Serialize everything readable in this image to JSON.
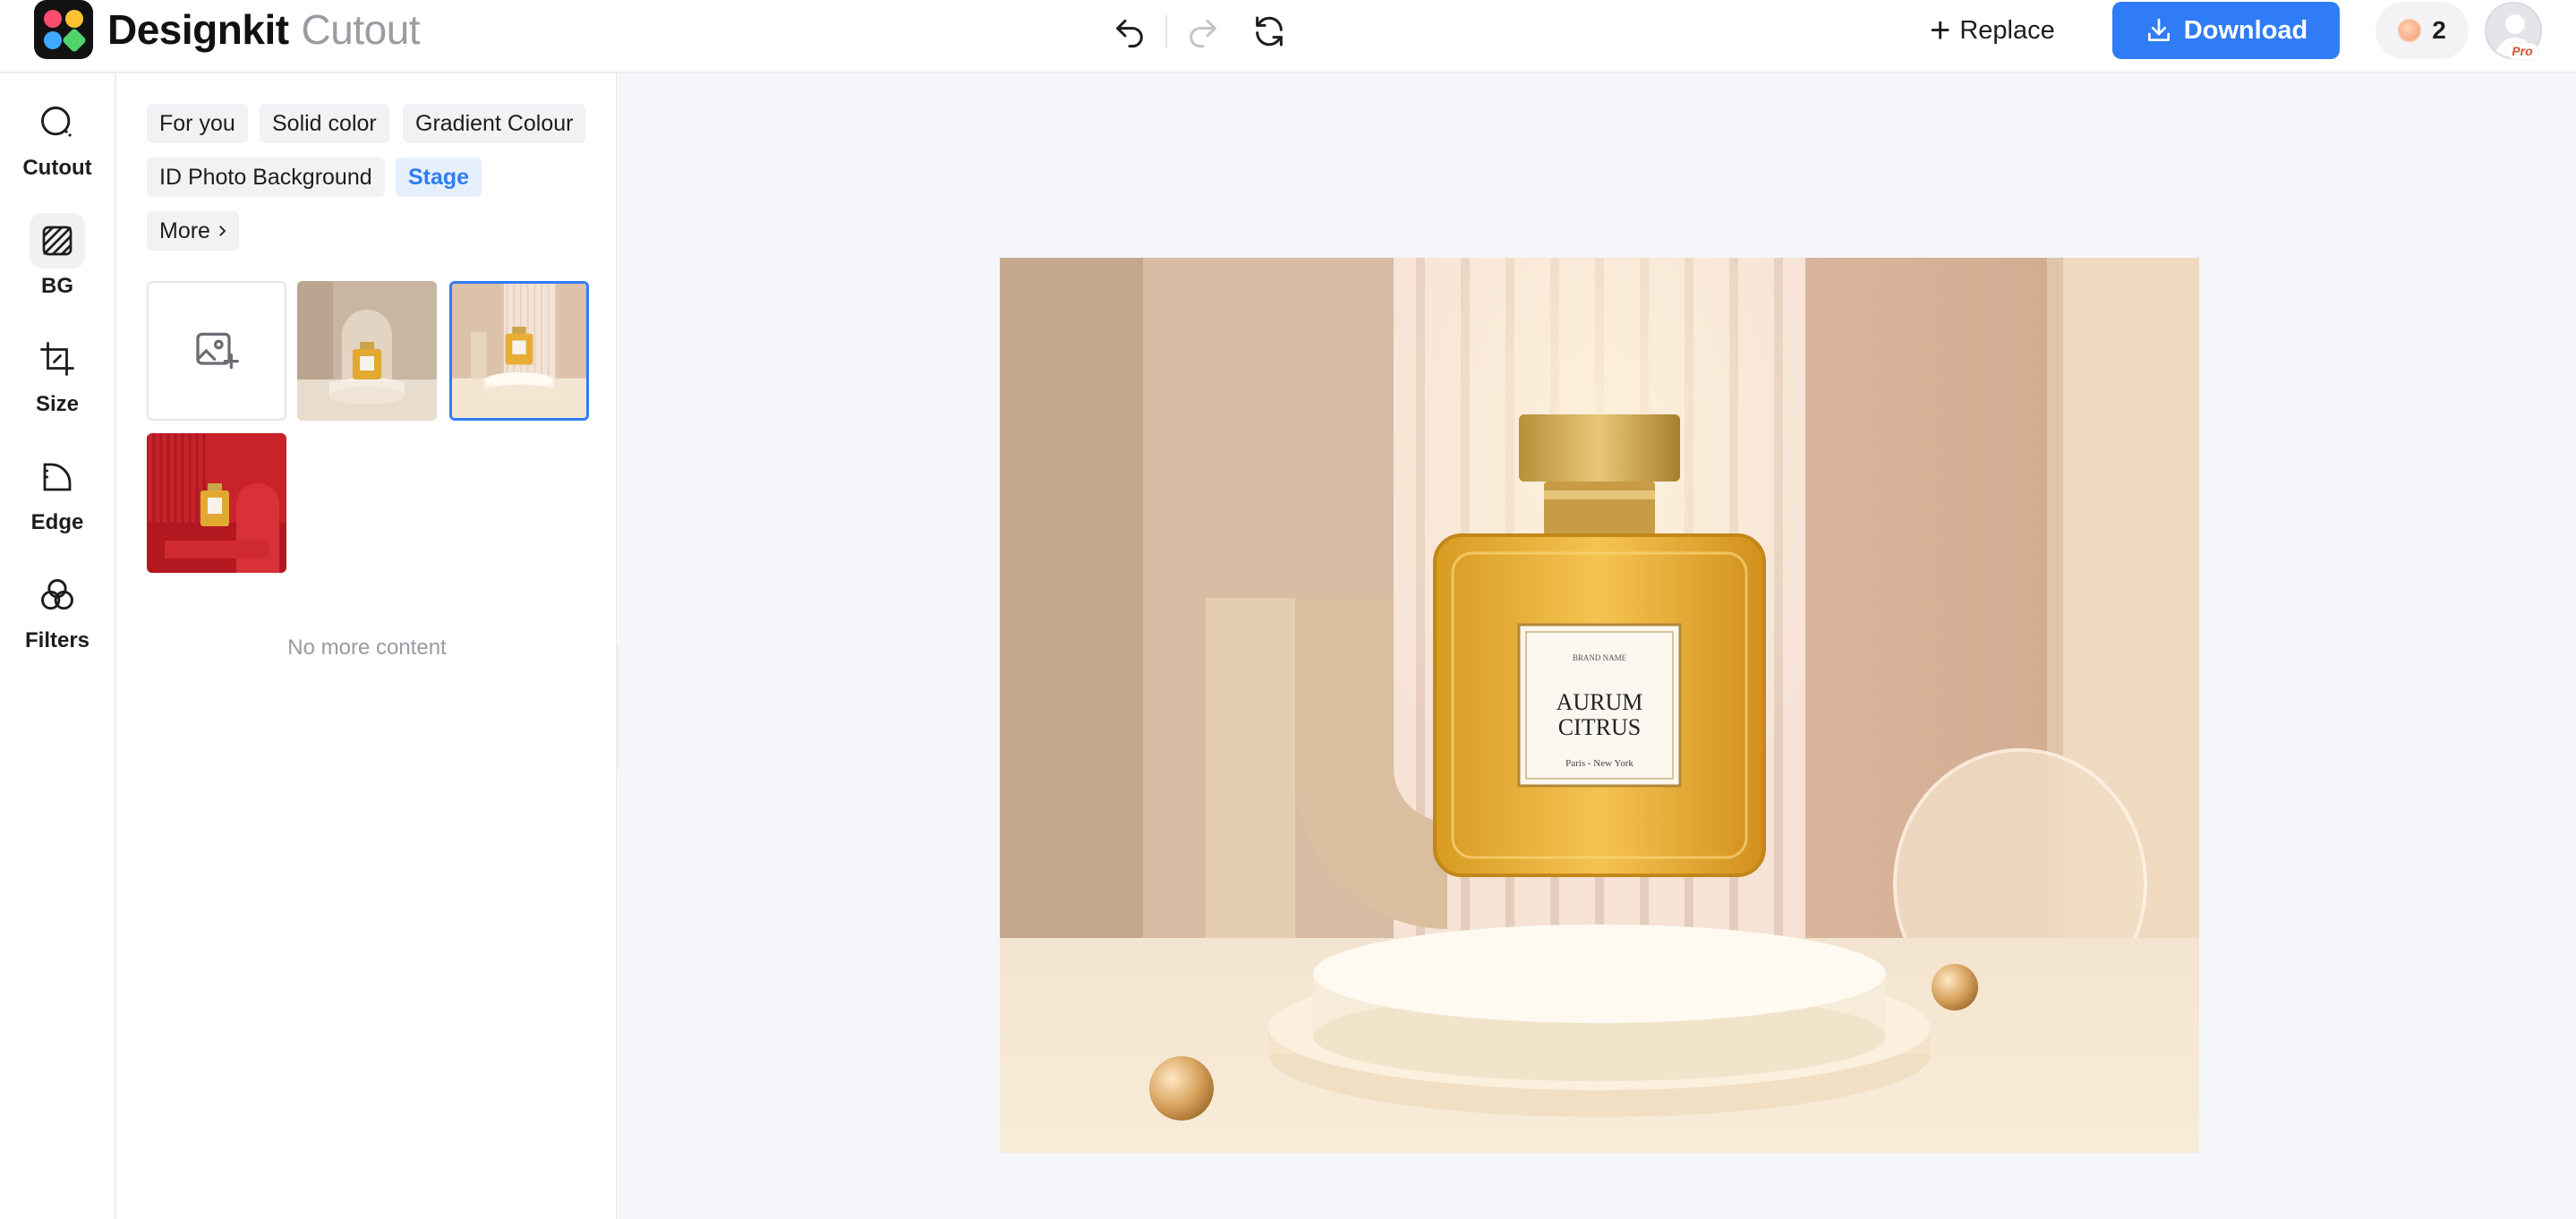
{
  "header": {
    "brand": "Designkit",
    "product": "Cutout",
    "replace_label": "Replace",
    "download_label": "Download",
    "credits": "2",
    "pro_badge": "Pro"
  },
  "rail": {
    "items": [
      {
        "label": "Cutout",
        "icon": "cutout-icon",
        "active": false
      },
      {
        "label": "BG",
        "icon": "bg-icon",
        "active": true
      },
      {
        "label": "Size",
        "icon": "crop-icon",
        "active": false
      },
      {
        "label": "Edge",
        "icon": "edge-icon",
        "active": false
      },
      {
        "label": "Filters",
        "icon": "filters-icon",
        "active": false
      }
    ]
  },
  "panel": {
    "tabs": [
      {
        "label": "For you",
        "active": false
      },
      {
        "label": "Solid color",
        "active": false
      },
      {
        "label": "Gradient Colour",
        "active": false
      },
      {
        "label": "ID Photo Background",
        "active": false
      },
      {
        "label": "Stage",
        "active": true
      },
      {
        "label": "More",
        "active": false
      }
    ],
    "no_more": "No more content"
  },
  "product": {
    "label_brand": "BRAND NAME",
    "label_name_1": "AURUM",
    "label_name_2": "CITRUS",
    "label_sub": "Paris - New York"
  },
  "colors": {
    "accent": "#2f7cf6",
    "canvas_bg": "#f5f6f9"
  }
}
